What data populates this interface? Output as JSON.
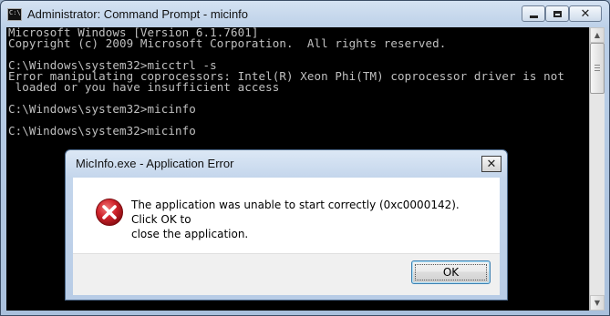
{
  "window": {
    "title": "Administrator: Command Prompt - micinfo",
    "icon_text": "C:\\",
    "caption_buttons": {
      "minimize": "minimize-icon",
      "maximize": "maximize-icon",
      "close": "✕"
    }
  },
  "console": {
    "lines": [
      "Microsoft Windows [Version 6.1.7601]",
      "Copyright (c) 2009 Microsoft Corporation.  All rights reserved.",
      "",
      "C:\\Windows\\system32>micctrl -s",
      "Error manipulating coprocessors: Intel(R) Xeon Phi(TM) coprocessor driver is not",
      " loaded or you have insufficient access",
      "",
      "C:\\Windows\\system32>micinfo",
      "",
      "C:\\Windows\\system32>micinfo"
    ],
    "colors": {
      "background": "#000000",
      "text": "#c0c0c0"
    }
  },
  "scrollbar": {
    "up_arrow": "▲",
    "down_arrow": "▼"
  },
  "dialog": {
    "title": "MicInfo.exe - Application Error",
    "close_label": "✕",
    "message_line1": "The application was unable to start correctly (0xc0000142). Click OK to",
    "message_line2": "close the application.",
    "icon": "error-icon",
    "ok_label": "OK",
    "colors": {
      "error_red": "#d0232b"
    }
  }
}
